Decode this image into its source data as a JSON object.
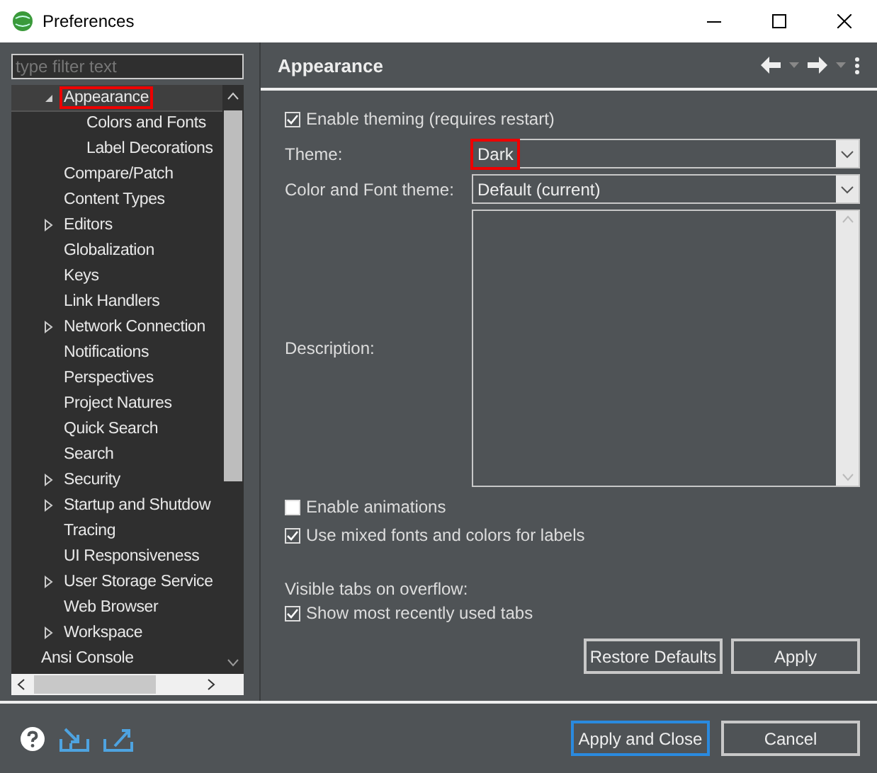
{
  "window": {
    "title": "Preferences"
  },
  "filter": {
    "placeholder": "type filter text"
  },
  "tree": {
    "items": [
      {
        "children": [
          {
            "label": "Appearance",
            "expandable": true,
            "expanded": true,
            "selected": true,
            "highlighted": true,
            "children": [
              {
                "label": "Colors and Fonts",
                "expandable": false,
                "selected": false,
                "highlighted": false
              },
              {
                "label": "Label Decorations",
                "expandable": false,
                "selected": false,
                "highlighted": false
              }
            ]
          },
          {
            "label": "Compare/Patch",
            "expandable": false,
            "selected": false,
            "highlighted": false
          },
          {
            "label": "Content Types",
            "expandable": false,
            "selected": false,
            "highlighted": false
          },
          {
            "label": "Editors",
            "expandable": true,
            "expanded": false,
            "selected": false,
            "highlighted": false
          },
          {
            "label": "Globalization",
            "expandable": false,
            "selected": false,
            "highlighted": false
          },
          {
            "label": "Keys",
            "expandable": false,
            "selected": false,
            "highlighted": false
          },
          {
            "label": "Link Handlers",
            "expandable": false,
            "selected": false,
            "highlighted": false
          },
          {
            "label": "Network Connection",
            "expandable": true,
            "expanded": false,
            "selected": false,
            "highlighted": false
          },
          {
            "label": "Notifications",
            "expandable": false,
            "selected": false,
            "highlighted": false
          },
          {
            "label": "Perspectives",
            "expandable": false,
            "selected": false,
            "highlighted": false
          },
          {
            "label": "Project Natures",
            "expandable": false,
            "selected": false,
            "highlighted": false
          },
          {
            "label": "Quick Search",
            "expandable": false,
            "selected": false,
            "highlighted": false
          },
          {
            "label": "Search",
            "expandable": false,
            "selected": false,
            "highlighted": false
          },
          {
            "label": "Security",
            "expandable": true,
            "expanded": false,
            "selected": false,
            "highlighted": false
          },
          {
            "label": "Startup and Shutdow",
            "expandable": true,
            "expanded": false,
            "selected": false,
            "highlighted": false
          },
          {
            "label": "Tracing",
            "expandable": false,
            "selected": false,
            "highlighted": false
          },
          {
            "label": "UI Responsiveness",
            "expandable": false,
            "selected": false,
            "highlighted": false
          },
          {
            "label": "User Storage Service",
            "expandable": true,
            "expanded": false,
            "selected": false,
            "highlighted": false
          },
          {
            "label": "Web Browser",
            "expandable": false,
            "selected": false,
            "highlighted": false
          },
          {
            "label": "Workspace",
            "expandable": true,
            "expanded": false,
            "selected": false,
            "highlighted": false
          }
        ]
      },
      {
        "label": "Ansi Console",
        "expandable": false,
        "selected": false,
        "highlighted": false
      }
    ]
  },
  "page": {
    "title": "Appearance",
    "enable_theming": {
      "label": "Enable theming (requires restart)",
      "checked": true
    },
    "theme": {
      "label": "Theme:",
      "value": "Dark",
      "highlighted": true
    },
    "color_font_theme": {
      "label": "Color and Font theme:",
      "value": "Default (current)",
      "highlighted": false
    },
    "description": {
      "label": "Description:"
    },
    "enable_animations": {
      "label": "Enable animations",
      "checked": false
    },
    "mixed_fonts": {
      "label": "Use mixed fonts and colors for labels",
      "checked": true
    },
    "overflow_label": "Visible tabs on overflow:",
    "recent_tabs": {
      "label": "Show most recently used tabs",
      "checked": true
    },
    "buttons": [
      {
        "label": "Restore Defaults",
        "default": false
      },
      {
        "label": "Apply",
        "default": false
      }
    ]
  },
  "footer": {
    "buttons": [
      {
        "label": "Apply and Close",
        "default": true
      },
      {
        "label": "Cancel",
        "default": false
      }
    ]
  }
}
